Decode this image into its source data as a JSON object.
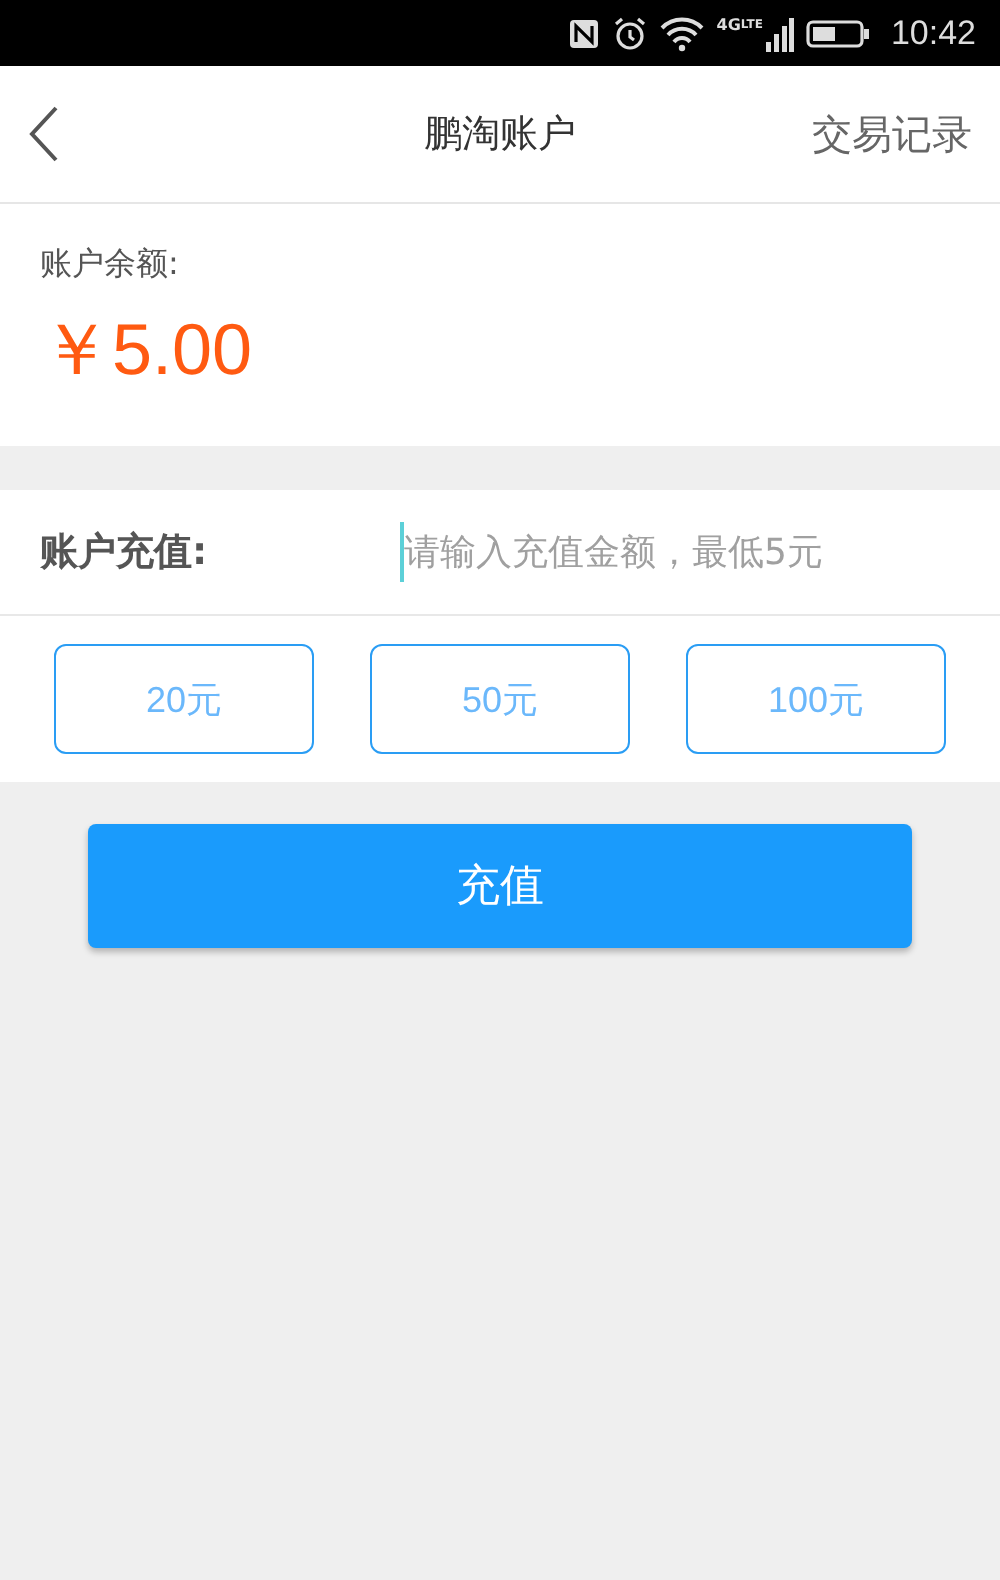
{
  "status_bar": {
    "network": "4G",
    "network_sub": "LTE",
    "time": "10:42"
  },
  "header": {
    "title": "鹏淘账户",
    "action": "交易记录"
  },
  "balance": {
    "label": "账户余额:",
    "amount": "￥5.00"
  },
  "recharge": {
    "label": "账户充值:",
    "placeholder": "请输入充值金额，最低5元",
    "focused": true
  },
  "presets": [
    {
      "label": "20元"
    },
    {
      "label": "50元"
    },
    {
      "label": "100元"
    }
  ],
  "submit": {
    "label": "充值"
  }
}
